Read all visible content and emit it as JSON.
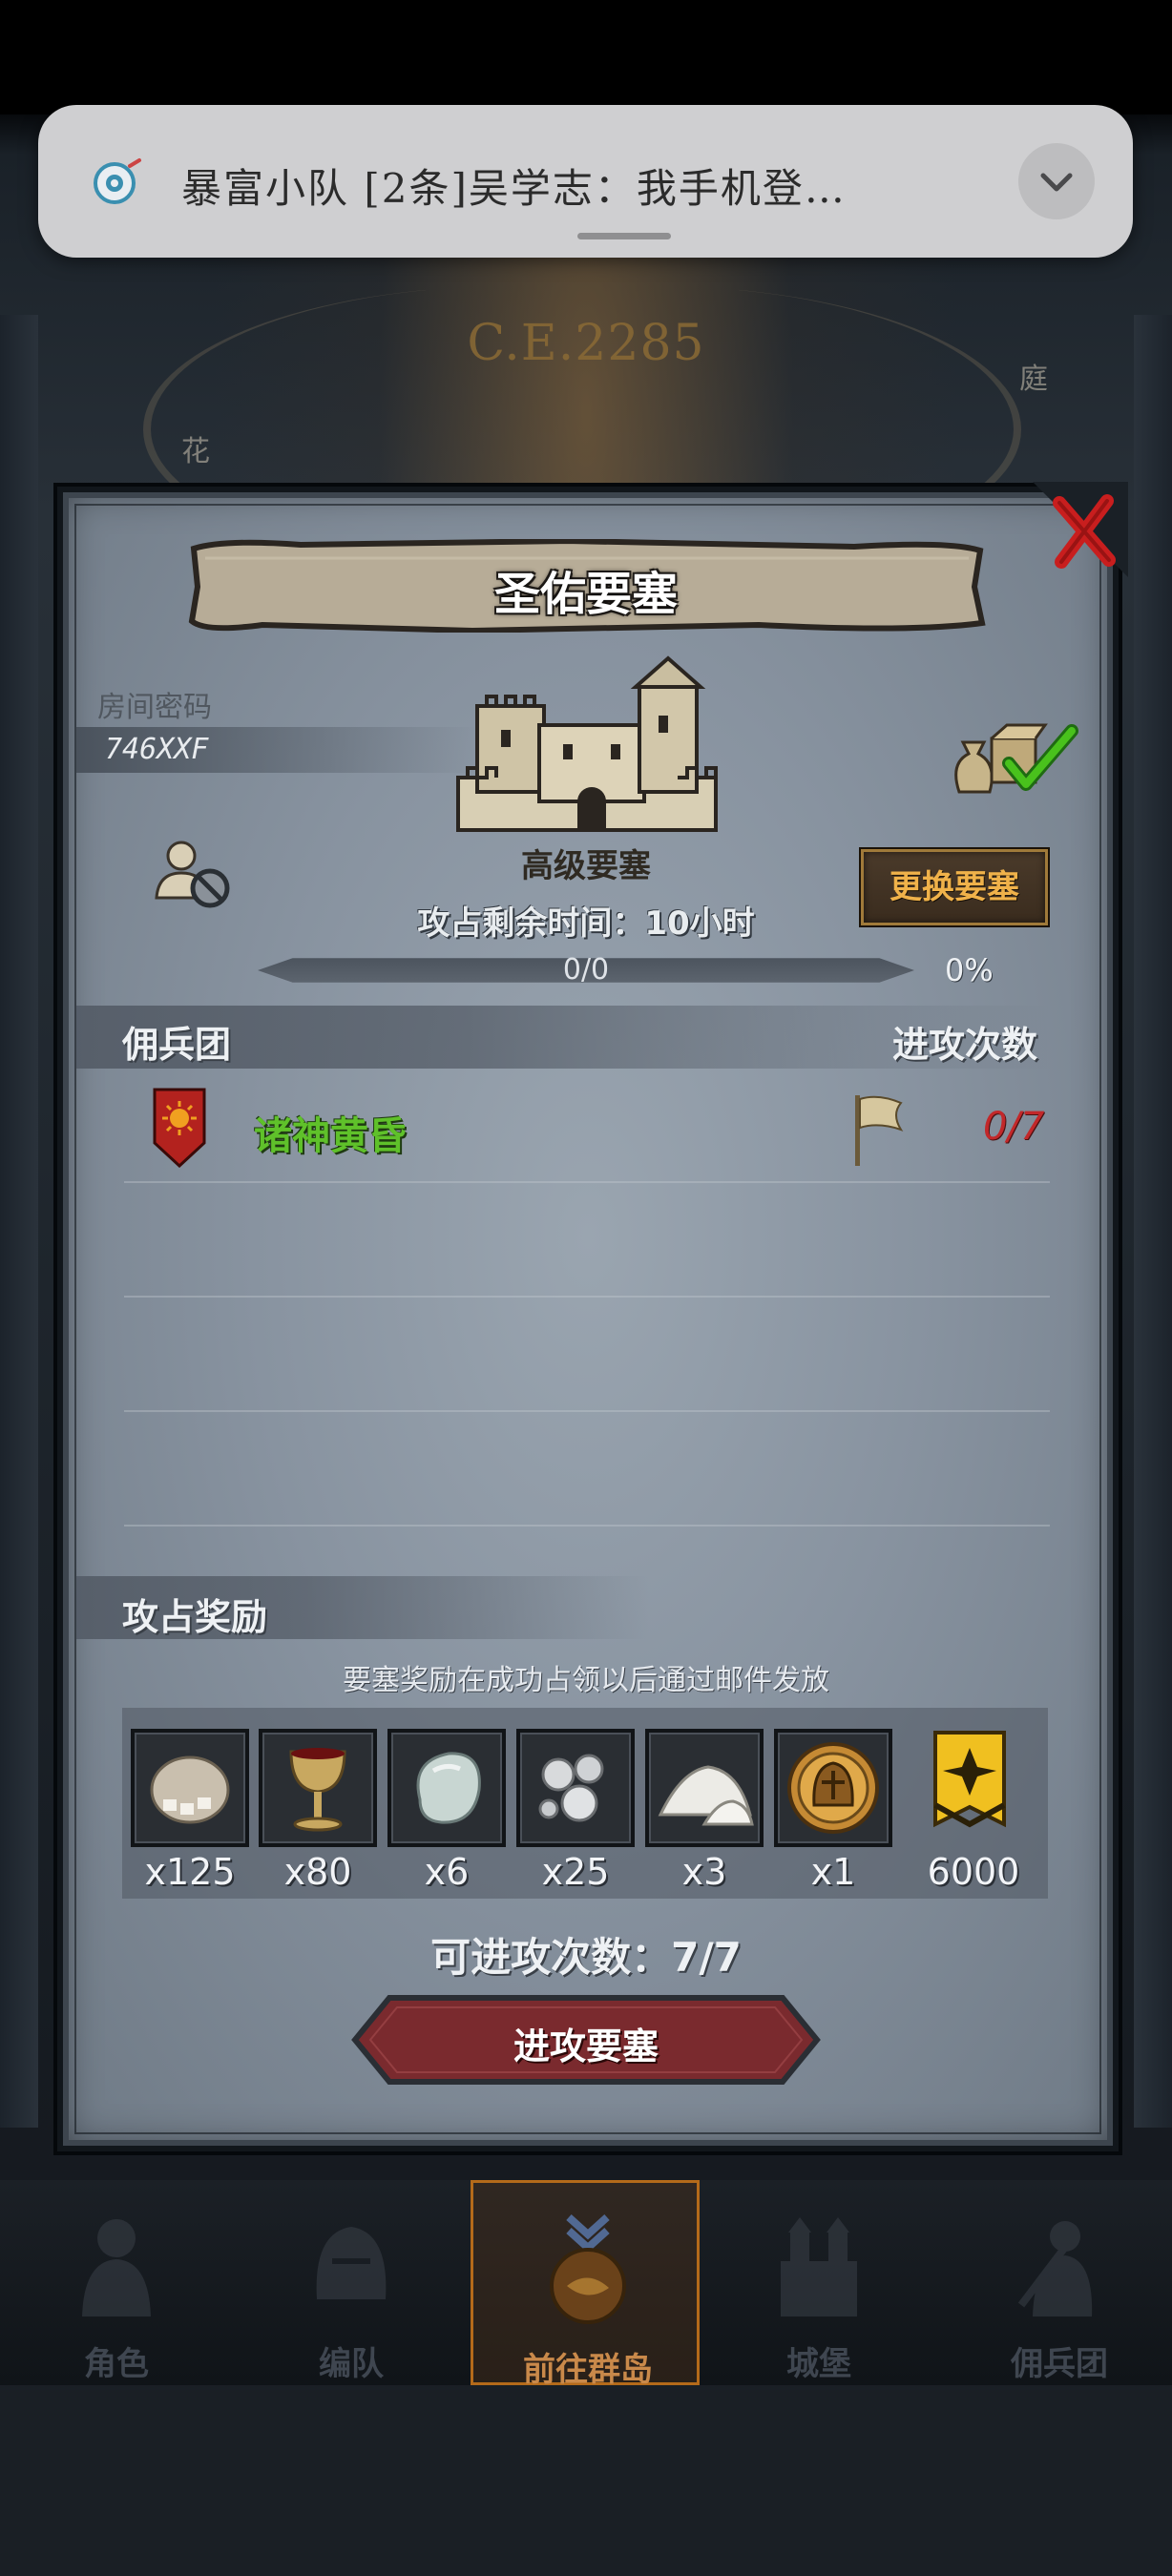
{
  "background": {
    "era_label": "C.E.2285",
    "left_label": "花",
    "right_label": "庭"
  },
  "notification": {
    "text": "暴富小队 [2条]吴学志：我手机登…",
    "icon": "app-icon",
    "expand_icon": "chevron-down-icon"
  },
  "dialog": {
    "title": "圣佑要塞",
    "room_code_label": "房间密码",
    "room_code": "746XXF",
    "fortress_level": "高级要塞",
    "change_button": "更换要塞",
    "time_remaining": "攻占剩余时间：10小时",
    "progress": {
      "text": "0/0",
      "percent_label": "0%",
      "fraction": 0
    },
    "mercenary_header": "佣兵团",
    "attack_count_header": "进攻次数",
    "mercenaries": [
      {
        "name": "诸神黄昏",
        "attack_count": "0/7"
      }
    ],
    "reward_header": "攻占奖励",
    "reward_note": "要塞奖励在成功占领以后通过邮件发放",
    "rewards": [
      {
        "icon": "ore-sack-icon",
        "qty": "x125"
      },
      {
        "icon": "goblet-icon",
        "qty": "x80"
      },
      {
        "icon": "gem-stone-icon",
        "qty": "x6"
      },
      {
        "icon": "silver-pearls-icon",
        "qty": "x25"
      },
      {
        "icon": "white-powder-icon",
        "qty": "x3"
      },
      {
        "icon": "knight-helmet-coin-icon",
        "qty": "x1"
      },
      {
        "icon": "gold-banner-icon",
        "qty": "6000"
      }
    ],
    "attacks_available": "可进攻次数：7/7",
    "attack_button": "进攻要塞"
  },
  "bottom_nav": [
    {
      "label": "角色"
    },
    {
      "label": "编队"
    },
    {
      "label": "前往群岛"
    },
    {
      "label": "城堡"
    },
    {
      "label": "佣兵团"
    }
  ],
  "colors": {
    "accent_green": "#5fc12a",
    "count_red": "#c2282a",
    "button_gold": "#f0b24a",
    "attack_button_red": "#7a2a2e"
  }
}
